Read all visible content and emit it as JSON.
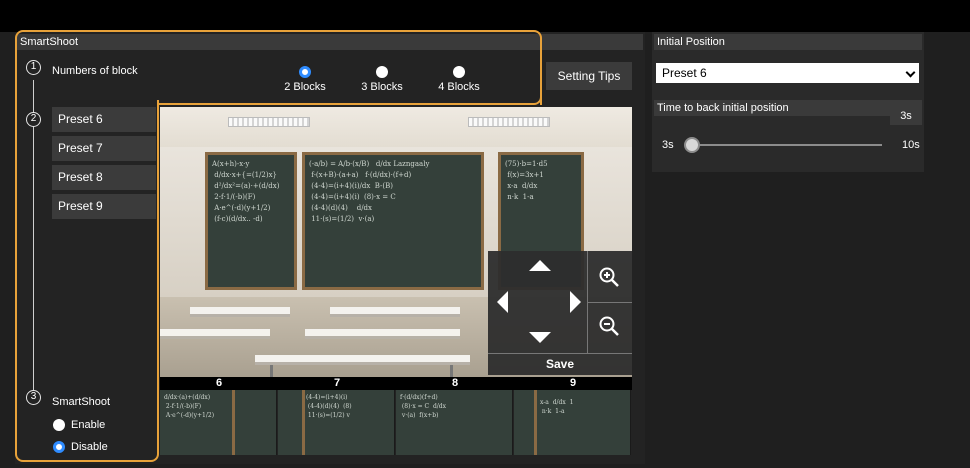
{
  "smartshoot_panel": {
    "title": "SmartShoot",
    "steps": [
      "1",
      "2",
      "3"
    ],
    "numbers_of_block": {
      "label": "Numbers of block",
      "options": [
        "2 Blocks",
        "3 Blocks",
        "4 Blocks"
      ],
      "selected": "2 Blocks"
    },
    "setting_tips_label": "Setting Tips",
    "presets": [
      "Preset 6",
      "Preset 7",
      "Preset 8",
      "Preset 9"
    ],
    "smartshoot_toggle": {
      "label": "SmartShoot",
      "options": [
        "Enable",
        "Disable"
      ],
      "selected": "Disable"
    },
    "ptz": {
      "save_label": "Save"
    },
    "block_numbers": [
      "6",
      "7",
      "8",
      "9"
    ]
  },
  "initial_position_panel": {
    "title": "Initial Position",
    "selected_preset": "Preset 6",
    "time_back": {
      "title": "Time to back initial position",
      "value_label": "3s",
      "min_label": "3s",
      "max_label": "10s",
      "value": 3,
      "min": 3,
      "max": 10
    }
  },
  "colors": {
    "accent_orange": "#e8a23a",
    "radio_selected": "#2f8cff",
    "button_bg": "#3b3b3b"
  },
  "icons": [
    "chevron-down-icon",
    "arrow-up-icon",
    "arrow-down-icon",
    "arrow-left-icon",
    "arrow-right-icon",
    "zoom-in-icon",
    "zoom-out-icon"
  ]
}
